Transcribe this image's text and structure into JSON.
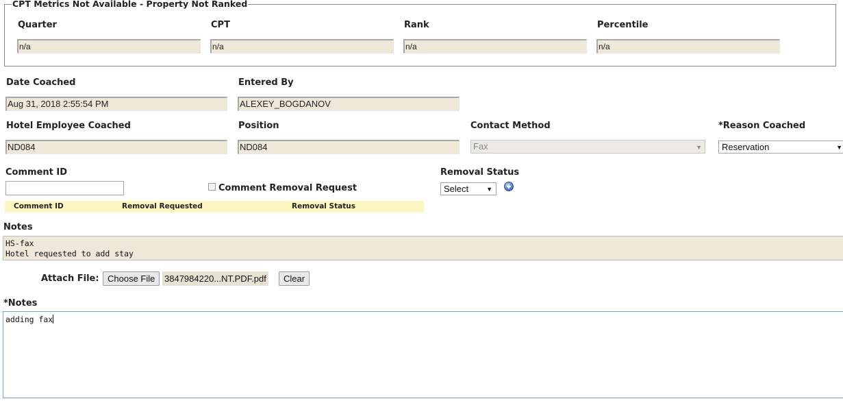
{
  "cpt": {
    "legend": "CPT Metrics Not Available - Property Not Ranked",
    "quarter_label": "Quarter",
    "quarter_value": "n/a",
    "cpt_label": "CPT",
    "cpt_value": "n/a",
    "rank_label": "Rank",
    "rank_value": "n/a",
    "percentile_label": "Percentile",
    "percentile_value": "n/a"
  },
  "coaching": {
    "date_coached_label": "Date Coached",
    "date_coached_value": "Aug 31, 2018 2:55:54 PM",
    "entered_by_label": "Entered By",
    "entered_by_value": "ALEXEY_BOGDANOV",
    "employee_label": "Hotel Employee Coached",
    "employee_value": "ND084",
    "position_label": "Position",
    "position_value": "ND084",
    "contact_method_label": "Contact Method",
    "contact_method_value": "Fax",
    "reason_label": "*Reason Coached",
    "reason_value": "Reservation"
  },
  "comment": {
    "comment_id_label": "Comment ID",
    "comment_id_value": "",
    "removal_request_label": "Comment Removal Request",
    "removal_status_label": "Removal Status",
    "removal_status_value": "Select",
    "table_headers": [
      "Comment ID",
      "Removal Requested",
      "Removal Status"
    ]
  },
  "notes": {
    "label": "Notes",
    "line1": "HS-fax",
    "line2": "Hotel requested to add stay"
  },
  "attach": {
    "label": "Attach File:",
    "choose_label": "Choose File",
    "file_name": "3847984220...NT.PDF.pdf",
    "clear_label": "Clear"
  },
  "new_notes": {
    "label": "*Notes",
    "value": "adding fax"
  },
  "colors": {
    "readonly_bg": "#efe8d9",
    "table_header_bg": "#fdf6c0",
    "focus_border": "#7aa3d8"
  }
}
